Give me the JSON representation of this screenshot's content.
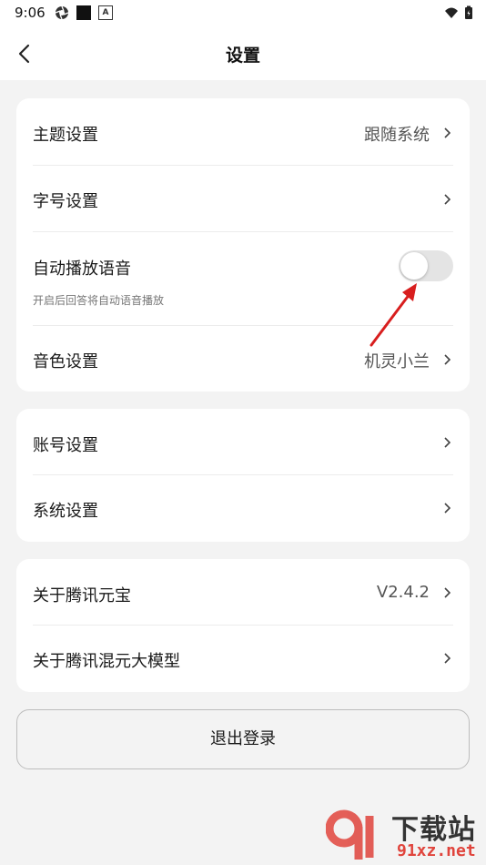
{
  "status_bar": {
    "time": "9:06"
  },
  "header": {
    "title": "设置"
  },
  "card1": {
    "theme": {
      "label": "主题设置",
      "value": "跟随系统"
    },
    "font_size": {
      "label": "字号设置"
    },
    "auto_play": {
      "label": "自动播放语音",
      "description": "开启后回答将自动语音播放",
      "enabled": false
    },
    "voice": {
      "label": "音色设置",
      "value": "机灵小兰"
    }
  },
  "card2": {
    "account": {
      "label": "账号设置"
    },
    "system": {
      "label": "系统设置"
    }
  },
  "card3": {
    "about_app": {
      "label": "关于腾讯元宝",
      "value": "V2.4.2"
    },
    "about_model": {
      "label": "关于腾讯混元大模型"
    }
  },
  "logout": {
    "label": "退出登录"
  },
  "watermark": {
    "brand": "下载站",
    "url": "91xz.net"
  },
  "colors": {
    "annotation_arrow": "#d81e1e",
    "watermark_red": "#e0443c"
  }
}
